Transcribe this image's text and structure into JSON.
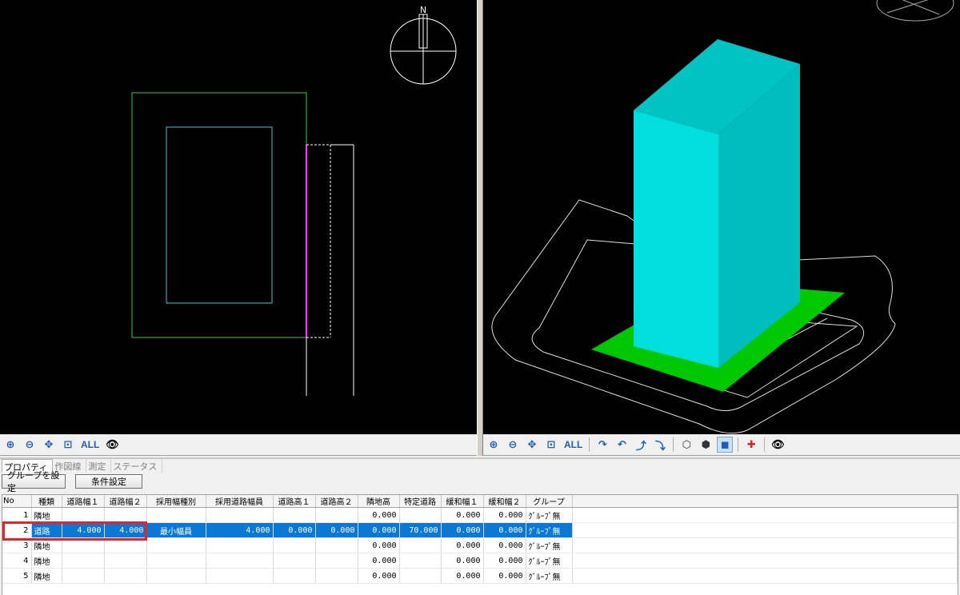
{
  "toolbar_left": {
    "all_label": "ALL",
    "icons": [
      "zoom-in-icon",
      "zoom-out-icon",
      "pan-icon",
      "zoom-window-icon",
      "view-icon"
    ]
  },
  "toolbar_right": {
    "all_label": "ALL",
    "icons": [
      "zoom-in-icon",
      "zoom-out-icon",
      "pan-icon",
      "zoom-window-icon",
      "rotate-right-icon",
      "rotate-left-icon",
      "rotate-up-icon",
      "rotate-down-icon",
      "wireframe-icon",
      "hidden-line-icon",
      "shaded-icon",
      "axis-icon",
      "view-icon"
    ]
  },
  "compass": {
    "north_label": "N"
  },
  "tabs": [
    "プロパティ",
    "作図線",
    "測定",
    "ステータス"
  ],
  "active_tab": "プロパティ",
  "buttons": {
    "group": "グループを設定",
    "condition": "条件設定"
  },
  "grid": {
    "columns": [
      "No",
      "種類",
      "道路幅１",
      "道路幅２",
      "採用幅種別",
      "採用道路幅員",
      "道路高１",
      "道路高２",
      "隣地高",
      "特定道路",
      "緩和幅１",
      "緩和幅２",
      "グループ"
    ],
    "rows": [
      {
        "no": "1",
        "kind": "隣地",
        "w1": "",
        "w2": "",
        "adopt_kind": "",
        "adopt_w": "",
        "h1": "",
        "h2": "",
        "adj_h": "0.000",
        "special": "",
        "ease1": "0.000",
        "ease2": "0.000",
        "group": "ｸﾞﾙｰﾌﾟ無"
      },
      {
        "no": "2",
        "kind": "道路",
        "w1": "4.000",
        "w2": "4.000",
        "adopt_kind": "最小幅員",
        "adopt_w": "4.000",
        "h1": "0.000",
        "h2": "0.000",
        "adj_h": "0.000",
        "special": "70.000",
        "ease1": "0.000",
        "ease2": "0.000",
        "group": "ｸﾞﾙｰﾌﾟ無"
      },
      {
        "no": "3",
        "kind": "隣地",
        "w1": "",
        "w2": "",
        "adopt_kind": "",
        "adopt_w": "",
        "h1": "",
        "h2": "",
        "adj_h": "0.000",
        "special": "",
        "ease1": "0.000",
        "ease2": "0.000",
        "group": "ｸﾞﾙｰﾌﾟ無"
      },
      {
        "no": "4",
        "kind": "隣地",
        "w1": "",
        "w2": "",
        "adopt_kind": "",
        "adopt_w": "",
        "h1": "",
        "h2": "",
        "adj_h": "0.000",
        "special": "",
        "ease1": "0.000",
        "ease2": "0.000",
        "group": "ｸﾞﾙｰﾌﾟ無"
      },
      {
        "no": "5",
        "kind": "隣地",
        "w1": "",
        "w2": "",
        "adopt_kind": "",
        "adopt_w": "",
        "h1": "",
        "h2": "",
        "adj_h": "0.000",
        "special": "",
        "ease1": "0.000",
        "ease2": "0.000",
        "group": "ｸﾞﾙｰﾌﾟ無"
      }
    ],
    "selected_row": 2
  },
  "colors": {
    "viewport_bg": "#000000",
    "site_outline": "#33cc33",
    "building_outline": "#33cccc",
    "road_edge": "#ff33ff",
    "building_fill": "#00dcdc",
    "site_fill": "#00c800",
    "selection": "#0a78d4",
    "highlight": "#e0262a"
  }
}
